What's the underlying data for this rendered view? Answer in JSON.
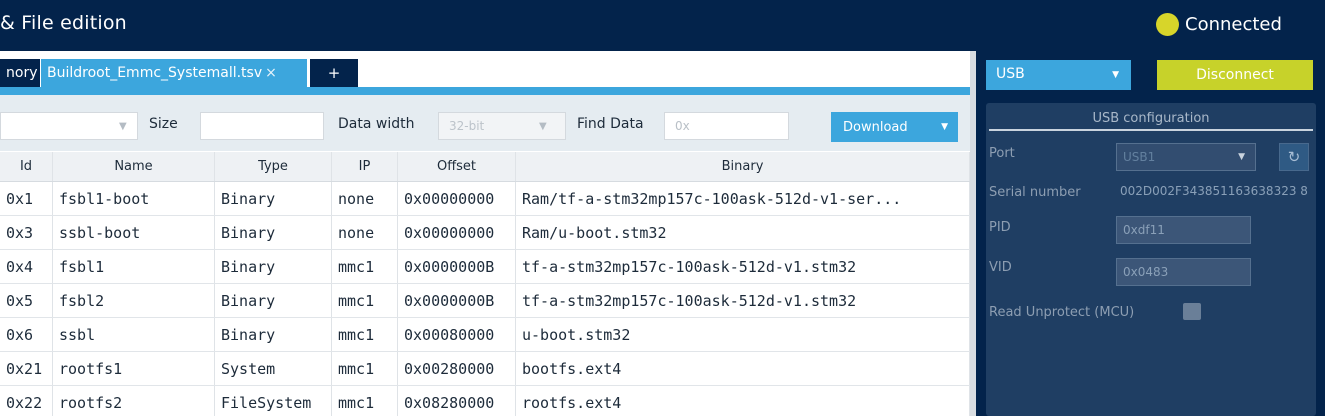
{
  "window": {
    "title": "& File edition",
    "status": "Connected",
    "status_color": "#d7d52a",
    "bg_color": "#03234b",
    "accent_color": "#3ca6dd"
  },
  "tabs": [
    {
      "label": "nory",
      "active": false
    },
    {
      "label": "Buildroot_Emmc_Systemall.tsv",
      "close": "×",
      "active": true
    },
    {
      "label": "+",
      "active": false
    }
  ],
  "toolbar": {
    "size_label": "Size",
    "size_value": "",
    "data_width_label": "Data width",
    "data_width_value": "32-bit",
    "find_label": "Find Data",
    "find_placeholder": "0x",
    "download_label": "Download"
  },
  "table": {
    "columns": [
      "Id",
      "Name",
      "Type",
      "IP",
      "Offset",
      "Binary"
    ],
    "rows": [
      [
        "0x1",
        "fsbl1-boot",
        "Binary",
        "none",
        "0x00000000",
        "Ram/tf-a-stm32mp157c-100ask-512d-v1-ser..."
      ],
      [
        "0x3",
        "ssbl-boot",
        "Binary",
        "none",
        "0x00000000",
        "Ram/u-boot.stm32"
      ],
      [
        "0x4",
        "fsbl1",
        "Binary",
        "mmc1",
        "0x0000000B",
        "tf-a-stm32mp157c-100ask-512d-v1.stm32"
      ],
      [
        "0x5",
        "fsbl2",
        "Binary",
        "mmc1",
        "0x0000000B",
        "tf-a-stm32mp157c-100ask-512d-v1.stm32"
      ],
      [
        "0x6",
        "ssbl",
        "Binary",
        "mmc1",
        "0x00080000",
        "u-boot.stm32"
      ],
      [
        "0x21",
        "rootfs1",
        "System",
        "mmc1",
        "0x00280000",
        "bootfs.ext4"
      ],
      [
        "0x22",
        "rootfs2",
        "FileSystem",
        "mmc1",
        "0x08280000",
        "rootfs.ext4"
      ]
    ]
  },
  "connection": {
    "interface_value": "USB",
    "disconnect_label": "Disconnect",
    "disconnect_color": "#c7d22a"
  },
  "usb_config": {
    "title": "USB configuration",
    "port_label": "Port",
    "port_value": "USB1",
    "serial_label": "Serial number",
    "serial_value": "002D002F343851163638323 8",
    "pid_label": "PID",
    "pid_value": "0xdf11",
    "vid_label": "VID",
    "vid_value": "0x0483",
    "read_unprotect_label": "Read Unprotect (MCU)",
    "read_unprotect_checked": false
  }
}
